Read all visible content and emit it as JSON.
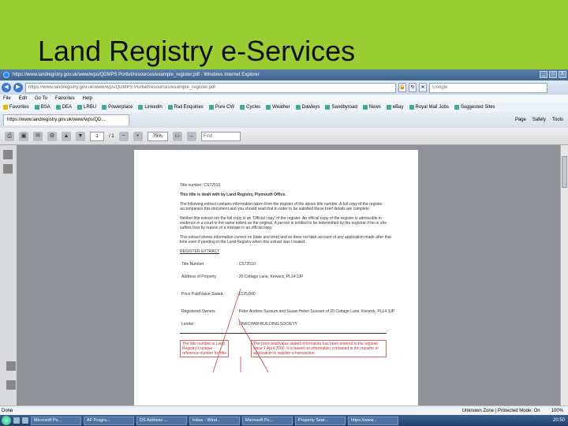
{
  "slide": {
    "title": "Land Registry e-Services"
  },
  "window": {
    "title": "https://www.landregistry.gov.uk/www/wps/QDMPS Portlet/resources/example_register.pdf - Windows Internet Explorer",
    "address": "https://www.landregistry.gov.uk/www/wps/QDMPS Portlet/resources/example_register.pdf",
    "search_placeholder": "Google",
    "min": "_",
    "max": "□",
    "close": "X"
  },
  "menu": [
    "File",
    "Edit",
    "Go To",
    "Favorites",
    "Help"
  ],
  "favorites": [
    "Favorites",
    "BSA",
    "DEA",
    "LRBU",
    "Powerplace",
    "Linkedin",
    "Rail Enquiries",
    "Pure CW",
    "Cycles",
    "Weather",
    "Dawleys",
    "Sandbyroad",
    "News",
    "eBay",
    "Royal Mail Jobs",
    "Suggested Sites"
  ],
  "tab": {
    "label": "https://www.landregistry.gov.uk/www/wps/QD..."
  },
  "tab_tools": [
    "Page",
    "Safety",
    "Tools"
  ],
  "pdf_toolbar": {
    "page": "1",
    "page_total": "/ 1",
    "zoom": "75%",
    "find_placeholder": "Find"
  },
  "document": {
    "title_number": "Title number: CS72510",
    "dealt_with": "This title is dealt with by Land Registry, Plymouth Office.",
    "para1": "The following extract contains information taken from the register of the above title number. A full copy of the register accompanies this document and you should read that in order to be satisfied these brief details are complete.",
    "para2": "Neither this extract nor the full copy is an 'Official copy' of the register. An official copy of the register is admissible in evidence in a court to the same extent as the original. A person is entitled to be indemnified by the registrar if he or she suffers loss by reason of a mistake in an official copy.",
    "para3": "This extract shows information current on [date and time] and so does not take account of any application made after that time even if pending in the Land Registry when this extract was created.",
    "heading": "REGISTER EXTRACT",
    "rows": [
      {
        "label": "Title Number",
        "value": ": CS72510"
      },
      {
        "label": "Address of Property",
        "value": ": 20 Cottage Lane, Kerwick, PL14 3JP"
      },
      {
        "label": "Price Paid/Value Stated",
        "value": ": £125,000"
      },
      {
        "label": "Registered Owners",
        "value": ": Peter Andrew Sussum and Susan Helen Sussum of 20 Cottage Lane, Kerwick, PL14 3JP"
      },
      {
        "label": "Lender",
        "value": ": LINKCHAM BUILDING SOCIETY"
      }
    ],
    "callout_left": "The title number is Land Registry's unique reference number for this",
    "callout_right": "The price paid/value stated information has been entered in the register since 1 April 2000. It is based on information contained in the transfer or application to register a transaction."
  },
  "status": {
    "left": "Done",
    "zone": "Unknown Zone | Protected Mode: On",
    "zoom": "100%"
  },
  "taskbar": {
    "tasks": [
      "Microsoft Po...",
      "AF Progra...",
      "DS Address ...",
      "Inbox - Wind...",
      "Microsoft Po...",
      "Property Sear...",
      "https://www..."
    ],
    "clock": "20:50"
  }
}
